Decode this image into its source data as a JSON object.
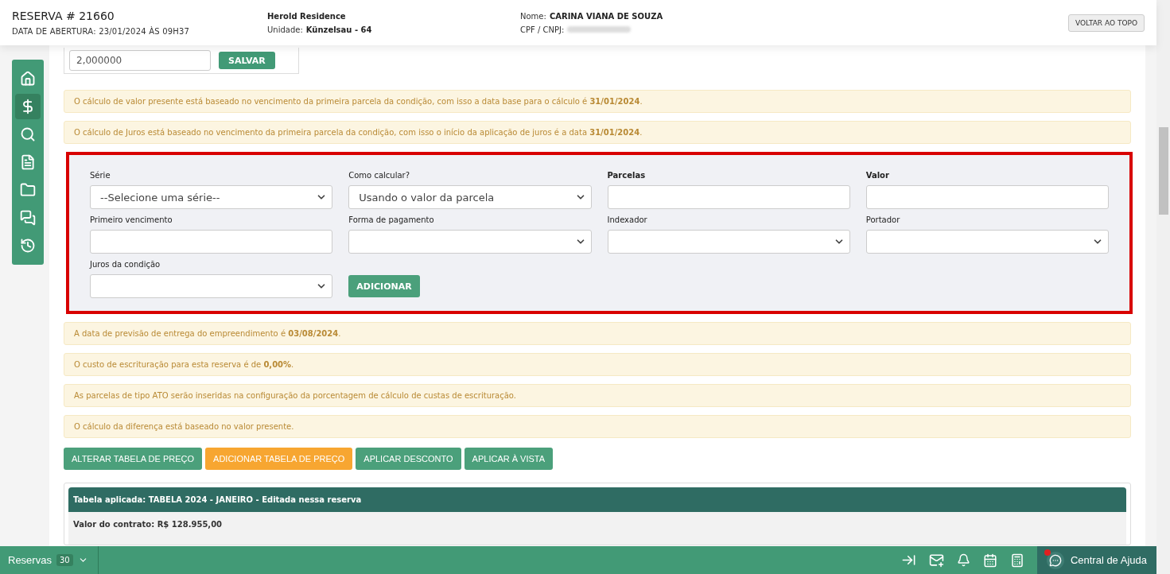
{
  "header": {
    "title": "RESERVA # 21660",
    "opened": "DATA DE ABERTURA: 23/01/2024 ÀS 09H37",
    "project": "Herold Residence",
    "unit_label": "Unidade:",
    "unit": "Künzelsau - 64",
    "name_label": "Nome:",
    "name": "CARINA VIANA DE SOUZA",
    "cpf_label": "CPF / CNPJ:",
    "back_button": "VOLTAR AO TOPO"
  },
  "partial_row": {
    "value": "2,000000",
    "button": "SALVAR"
  },
  "sidebar": {
    "items": [
      {
        "kind": "home",
        "selected": false
      },
      {
        "kind": "dollar",
        "selected": true
      },
      {
        "kind": "search",
        "selected": false
      },
      {
        "kind": "document",
        "selected": false
      },
      {
        "kind": "folder",
        "selected": false
      },
      {
        "kind": "chat",
        "selected": false
      },
      {
        "kind": "history",
        "selected": false
      }
    ]
  },
  "notices_top": [
    "O cálculo de valor presente está baseado no vencimento da primeira parcela da condição, com isso a data base para o cálculo é **31/01/2024**.",
    "O cálculo de Juros está baseado no vencimento da primeira parcela da condição, com isso o início da aplicação de juros é a data **31/01/2024**."
  ],
  "form": {
    "fields": [
      {
        "label": "Série",
        "bold": false,
        "kind": "select",
        "value": "--Selecione uma série--"
      },
      {
        "label": "Como calcular?",
        "bold": false,
        "kind": "select",
        "value": "Usando o valor da parcela"
      },
      {
        "label": "Parcelas",
        "bold": true,
        "kind": "input"
      },
      {
        "label": "Valor",
        "bold": true,
        "kind": "input"
      },
      {
        "label": "Primeiro vencimento",
        "bold": false,
        "kind": "input"
      },
      {
        "label": "Forma de pagamento",
        "bold": false,
        "kind": "select"
      },
      {
        "label": "Indexador",
        "bold": false,
        "kind": "select"
      },
      {
        "label": "Portador",
        "bold": false,
        "kind": "select"
      },
      {
        "label": "Juros da condição",
        "bold": false,
        "kind": "select"
      }
    ],
    "add_button": "ADICIONAR"
  },
  "notices_bottom": [
    "A data de previsão de entrega do empreendimento é **03/08/2024**.",
    "O custo de escrituração para esta reserva é de **0,00%**.",
    "As parcelas de tipo ATO serão inseridas na configuração da porcentagem de cálculo de custas de escrituração.",
    "O cálculo da diferença está baseado no valor presente."
  ],
  "actions": [
    {
      "label": "ALTERAR TABELA DE PREÇO",
      "kind": "primary"
    },
    {
      "label": "ADICIONAR TABELA DE PREÇO",
      "kind": "warning"
    },
    {
      "label": "APLICAR DESCONTO",
      "kind": "primary"
    },
    {
      "label": "APLICAR À VISTA",
      "kind": "primary"
    }
  ],
  "table": {
    "title": "Tabela aplicada: TABELA 2024 - JANEIRO - Editada nessa reserva",
    "contract": "Valor do contrato: R$ 128.955,00"
  },
  "bottom_bar": {
    "label": "Reservas",
    "count": "30",
    "help": "Central de Ajuda",
    "help_notification": true
  }
}
